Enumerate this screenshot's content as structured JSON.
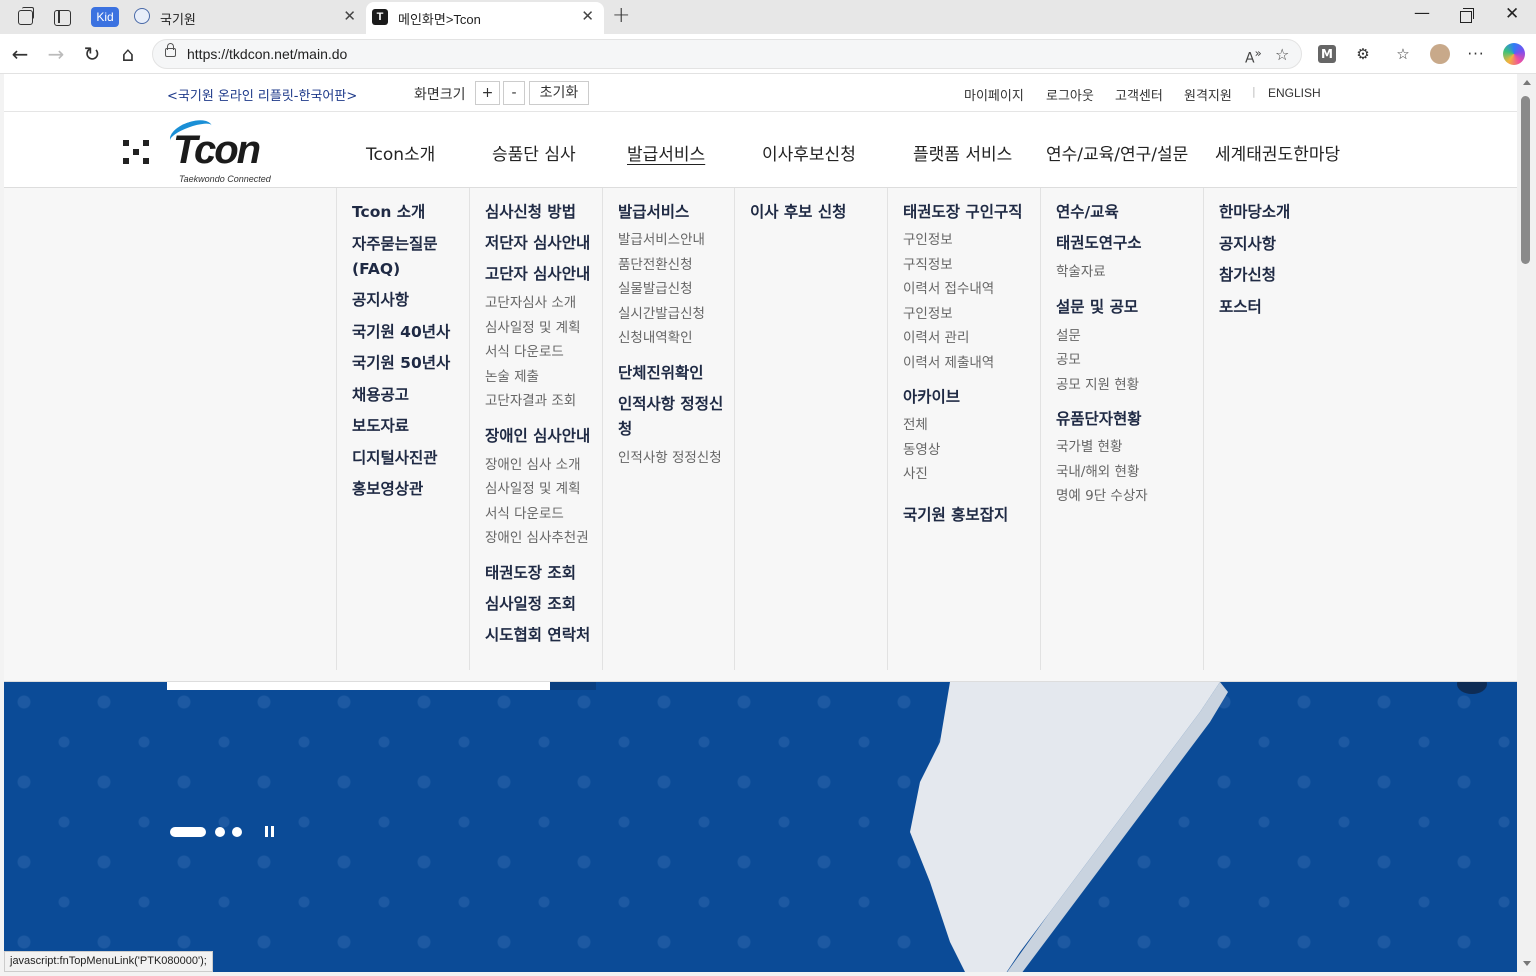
{
  "browser": {
    "tabs": [
      {
        "label": "국기원",
        "badge": "Kid"
      },
      {
        "label": "메인화면>Tcon",
        "favicon_letter": "T"
      }
    ],
    "url": "https://tkdcon.net/main.do",
    "profile_badge": "M",
    "status_text": "javascript:fnTopMenuLink('PTK080000');"
  },
  "util": {
    "replit": "<국기원 온라인 리플릿-한국어판>",
    "font_size_label": "화면크기",
    "font_plus": "+",
    "font_minus": "-",
    "font_reset": "초기화",
    "links": [
      "마이페이지",
      "로그아웃",
      "고객센터",
      "원격지원"
    ],
    "separator": "|",
    "english": "ENGLISH"
  },
  "logo": {
    "text": "Tcon",
    "subtitle": "Taekwondo Connected"
  },
  "gnb": [
    "Tcon소개",
    "승품단 심사",
    "발급서비스",
    "이사후보신청",
    "플랫폼 서비스",
    "연수/교육/연구/설문",
    "세계태권도한마당"
  ],
  "mega": {
    "col1": [
      "Tcon 소개",
      "자주묻는질문(FAQ)",
      "공지사항",
      "국기원 40년사",
      "국기원 50년사",
      "채용공고",
      "보도자료",
      "디지털사진관",
      "홍보영상관"
    ],
    "col2": {
      "h1": "심사신청 방법",
      "h2": "저단자 심사안내",
      "h3": "고단자 심사안내",
      "s3": [
        "고단자심사 소개",
        "심사일정 및 계획",
        "서식 다운로드",
        "논술 제출",
        "고단자결과 조회"
      ],
      "h4": "장애인 심사안내",
      "s4": [
        "장애인 심사 소개",
        "심사일정 및 계획",
        "서식 다운로드",
        "장애인 심사추천권"
      ],
      "h5": "태권도장 조회",
      "h6": "심사일정 조회",
      "h7": "시도협회 연락처"
    },
    "col3": {
      "h1": "발급서비스",
      "s1": [
        "발급서비스안내",
        "품단전환신청",
        "실물발급신청",
        "실시간발급신청",
        "신청내역확인"
      ],
      "h2": "단체진위확인",
      "h3": "인적사항 정정신청",
      "s3": [
        "인적사항 정정신청"
      ]
    },
    "col4": {
      "h1": "이사 후보 신청"
    },
    "col5": {
      "h1": "태권도장 구인구직",
      "s1": [
        "구인정보",
        "구직정보",
        "이력서 접수내역",
        "구인정보",
        "이력서 관리",
        "이력서 제출내역"
      ],
      "h2": "아카이브",
      "s2": [
        "전체",
        "동영상",
        "사진"
      ],
      "h3": "국기원 홍보잡지"
    },
    "col6": {
      "h1": "연수/교육",
      "h2": "태권도연구소",
      "s2": [
        "학술자료"
      ],
      "h3": "설문 및 공모",
      "s3": [
        "설문",
        "공모",
        "공모 지원 현황"
      ],
      "h4": "유품단자현황",
      "s4": [
        "국가별 현황",
        "국내/해외 현황",
        "명예 9단 수상자"
      ]
    },
    "col7": [
      "한마당소개",
      "공지사항",
      "참가신청",
      "포스터"
    ]
  },
  "colors": {
    "hero_bg": "#0b4b97",
    "accent_logo": "#1a8fd6",
    "menu_heading": "#1f2a44"
  }
}
